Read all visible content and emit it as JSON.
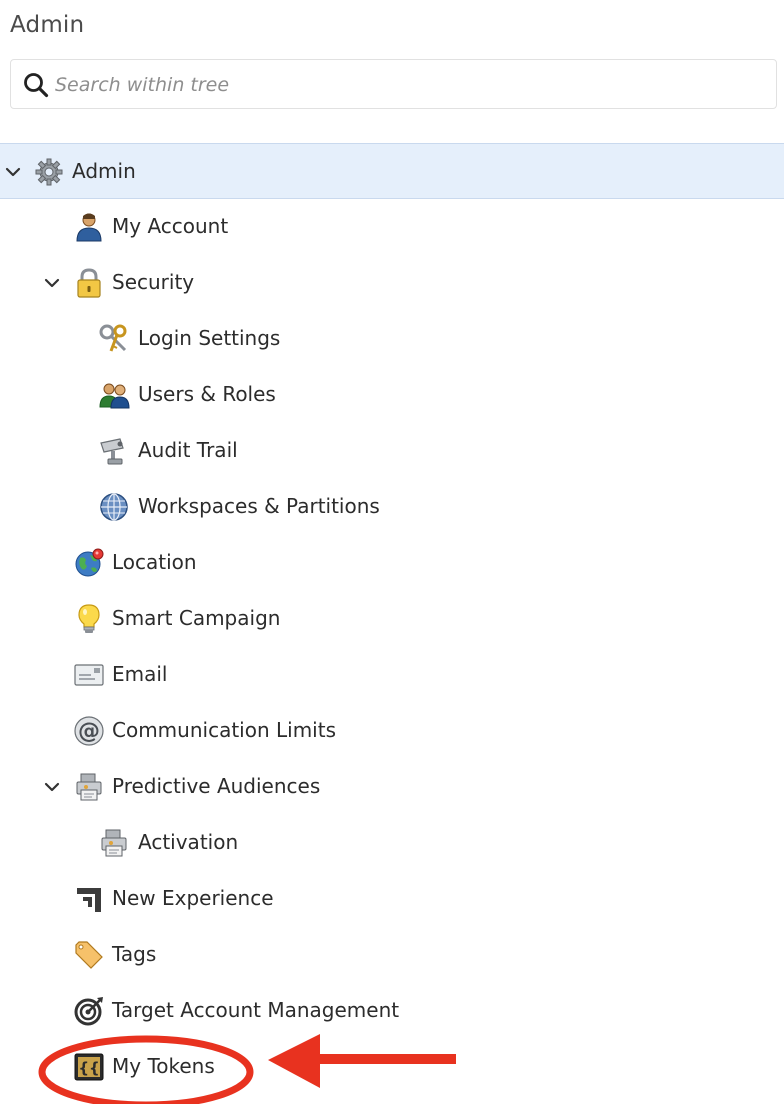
{
  "panel": {
    "title": "Admin"
  },
  "search": {
    "placeholder": "Search within tree",
    "icon": "search-icon"
  },
  "tree": {
    "admin": {
      "label": "Admin",
      "icon": "gear-icon",
      "expanded": true,
      "selected": true
    },
    "my_account": {
      "label": "My Account",
      "icon": "user-icon"
    },
    "security": {
      "label": "Security",
      "icon": "lock-icon",
      "expanded": true
    },
    "login_settings": {
      "label": "Login Settings",
      "icon": "key-icon"
    },
    "users_roles": {
      "label": "Users & Roles",
      "icon": "users-icon"
    },
    "audit_trail": {
      "label": "Audit Trail",
      "icon": "camera-icon"
    },
    "workspaces": {
      "label": "Workspaces & Partitions",
      "icon": "globe-grid-icon"
    },
    "location": {
      "label": "Location",
      "icon": "globe-pin-icon"
    },
    "smart_campaign": {
      "label": "Smart Campaign",
      "icon": "lightbulb-icon"
    },
    "email": {
      "label": "Email",
      "icon": "envelope-icon"
    },
    "communication_limits": {
      "label": "Communication Limits",
      "icon": "at-sign-icon"
    },
    "predictive_audiences": {
      "label": "Predictive Audiences",
      "icon": "audience-icon",
      "expanded": true
    },
    "activation": {
      "label": "Activation",
      "icon": "audience-icon"
    },
    "new_experience": {
      "label": "New Experience",
      "icon": "corner-bracket-icon"
    },
    "tags": {
      "label": "Tags",
      "icon": "tag-icon"
    },
    "target_account_management": {
      "label": "Target Account Management",
      "icon": "target-icon"
    },
    "my_tokens": {
      "label": "My Tokens",
      "icon": "token-icon"
    }
  },
  "colors": {
    "selected_row": "#e5effb",
    "annotation": "#e8321f"
  }
}
